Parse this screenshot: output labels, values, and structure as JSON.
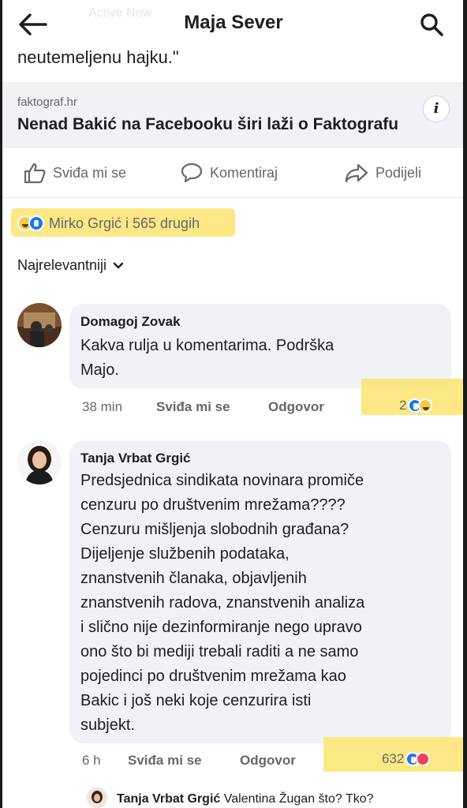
{
  "header": {
    "title": "Maja Sever",
    "ghost_text": "Active Now"
  },
  "post": {
    "quote_tail": "neutemeljenu hajku.\"",
    "link": {
      "domain": "faktograf.hr",
      "title": "Nenad Bakić na Facebooku širi laži o Faktografu"
    },
    "actions": {
      "like": "Sviđa mi se",
      "comment": "Komentiraj",
      "share": "Podijeli"
    },
    "reactions_summary": "Mirko Grgić i 565 drugih",
    "sort_label": "Najrelevantniji"
  },
  "comments": [
    {
      "author": "Domagoj Zovak",
      "lines": [
        "Kakva rulja u komentarima. Podrška",
        "Majo."
      ],
      "time": "38 min",
      "like_label": "Sviđa mi se",
      "reply_label": "Odgovor",
      "reaction_count": "2"
    },
    {
      "author": "Tanja Vrbat Grgić",
      "lines": [
        "Predsjednica sindikata novinara promiče",
        "cenzuru po društvenim mrežama????",
        "Cenzuru mišljenja slobodnih građana?",
        "Dijeljenje službenih podataka,",
        "znanstvenih članaka, objavljenih",
        "znanstvenih radova, znanstvenih analiza",
        "i slično nije dezinformiranje nego upravo",
        "ono što bi mediji trebali raditi a ne samo",
        "pojedinci po društvenim mrežama kao",
        "Bakic i još neki koje cenzurira isti",
        "subjekt."
      ],
      "time": "6 h",
      "like_label": "Sviđa mi se",
      "reply_label": "Odgovor",
      "reaction_count": "632"
    }
  ],
  "next_reply": {
    "author": "Tanja Vrbat Grgić",
    "text": "Valentina Žugan što? Tko?"
  },
  "colors": {
    "highlight": "#fce46f",
    "bubble": "#f0f2f5",
    "muted_text": "#65676b",
    "like_blue": "#1877f2"
  }
}
